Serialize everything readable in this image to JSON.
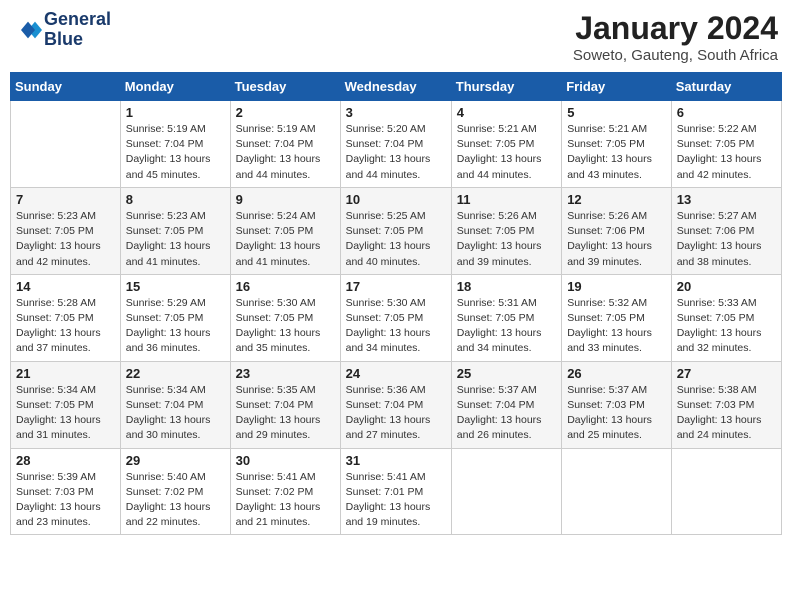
{
  "logo": {
    "line1": "General",
    "line2": "Blue"
  },
  "title": "January 2024",
  "location": "Soweto, Gauteng, South Africa",
  "weekdays": [
    "Sunday",
    "Monday",
    "Tuesday",
    "Wednesday",
    "Thursday",
    "Friday",
    "Saturday"
  ],
  "weeks": [
    [
      {
        "day": "",
        "info": ""
      },
      {
        "day": "1",
        "info": "Sunrise: 5:19 AM\nSunset: 7:04 PM\nDaylight: 13 hours\nand 45 minutes."
      },
      {
        "day": "2",
        "info": "Sunrise: 5:19 AM\nSunset: 7:04 PM\nDaylight: 13 hours\nand 44 minutes."
      },
      {
        "day": "3",
        "info": "Sunrise: 5:20 AM\nSunset: 7:04 PM\nDaylight: 13 hours\nand 44 minutes."
      },
      {
        "day": "4",
        "info": "Sunrise: 5:21 AM\nSunset: 7:05 PM\nDaylight: 13 hours\nand 44 minutes."
      },
      {
        "day": "5",
        "info": "Sunrise: 5:21 AM\nSunset: 7:05 PM\nDaylight: 13 hours\nand 43 minutes."
      },
      {
        "day": "6",
        "info": "Sunrise: 5:22 AM\nSunset: 7:05 PM\nDaylight: 13 hours\nand 42 minutes."
      }
    ],
    [
      {
        "day": "7",
        "info": "Sunrise: 5:23 AM\nSunset: 7:05 PM\nDaylight: 13 hours\nand 42 minutes."
      },
      {
        "day": "8",
        "info": "Sunrise: 5:23 AM\nSunset: 7:05 PM\nDaylight: 13 hours\nand 41 minutes."
      },
      {
        "day": "9",
        "info": "Sunrise: 5:24 AM\nSunset: 7:05 PM\nDaylight: 13 hours\nand 41 minutes."
      },
      {
        "day": "10",
        "info": "Sunrise: 5:25 AM\nSunset: 7:05 PM\nDaylight: 13 hours\nand 40 minutes."
      },
      {
        "day": "11",
        "info": "Sunrise: 5:26 AM\nSunset: 7:05 PM\nDaylight: 13 hours\nand 39 minutes."
      },
      {
        "day": "12",
        "info": "Sunrise: 5:26 AM\nSunset: 7:06 PM\nDaylight: 13 hours\nand 39 minutes."
      },
      {
        "day": "13",
        "info": "Sunrise: 5:27 AM\nSunset: 7:06 PM\nDaylight: 13 hours\nand 38 minutes."
      }
    ],
    [
      {
        "day": "14",
        "info": "Sunrise: 5:28 AM\nSunset: 7:05 PM\nDaylight: 13 hours\nand 37 minutes."
      },
      {
        "day": "15",
        "info": "Sunrise: 5:29 AM\nSunset: 7:05 PM\nDaylight: 13 hours\nand 36 minutes."
      },
      {
        "day": "16",
        "info": "Sunrise: 5:30 AM\nSunset: 7:05 PM\nDaylight: 13 hours\nand 35 minutes."
      },
      {
        "day": "17",
        "info": "Sunrise: 5:30 AM\nSunset: 7:05 PM\nDaylight: 13 hours\nand 34 minutes."
      },
      {
        "day": "18",
        "info": "Sunrise: 5:31 AM\nSunset: 7:05 PM\nDaylight: 13 hours\nand 34 minutes."
      },
      {
        "day": "19",
        "info": "Sunrise: 5:32 AM\nSunset: 7:05 PM\nDaylight: 13 hours\nand 33 minutes."
      },
      {
        "day": "20",
        "info": "Sunrise: 5:33 AM\nSunset: 7:05 PM\nDaylight: 13 hours\nand 32 minutes."
      }
    ],
    [
      {
        "day": "21",
        "info": "Sunrise: 5:34 AM\nSunset: 7:05 PM\nDaylight: 13 hours\nand 31 minutes."
      },
      {
        "day": "22",
        "info": "Sunrise: 5:34 AM\nSunset: 7:04 PM\nDaylight: 13 hours\nand 30 minutes."
      },
      {
        "day": "23",
        "info": "Sunrise: 5:35 AM\nSunset: 7:04 PM\nDaylight: 13 hours\nand 29 minutes."
      },
      {
        "day": "24",
        "info": "Sunrise: 5:36 AM\nSunset: 7:04 PM\nDaylight: 13 hours\nand 27 minutes."
      },
      {
        "day": "25",
        "info": "Sunrise: 5:37 AM\nSunset: 7:04 PM\nDaylight: 13 hours\nand 26 minutes."
      },
      {
        "day": "26",
        "info": "Sunrise: 5:37 AM\nSunset: 7:03 PM\nDaylight: 13 hours\nand 25 minutes."
      },
      {
        "day": "27",
        "info": "Sunrise: 5:38 AM\nSunset: 7:03 PM\nDaylight: 13 hours\nand 24 minutes."
      }
    ],
    [
      {
        "day": "28",
        "info": "Sunrise: 5:39 AM\nSunset: 7:03 PM\nDaylight: 13 hours\nand 23 minutes."
      },
      {
        "day": "29",
        "info": "Sunrise: 5:40 AM\nSunset: 7:02 PM\nDaylight: 13 hours\nand 22 minutes."
      },
      {
        "day": "30",
        "info": "Sunrise: 5:41 AM\nSunset: 7:02 PM\nDaylight: 13 hours\nand 21 minutes."
      },
      {
        "day": "31",
        "info": "Sunrise: 5:41 AM\nSunset: 7:01 PM\nDaylight: 13 hours\nand 19 minutes."
      },
      {
        "day": "",
        "info": ""
      },
      {
        "day": "",
        "info": ""
      },
      {
        "day": "",
        "info": ""
      }
    ]
  ]
}
